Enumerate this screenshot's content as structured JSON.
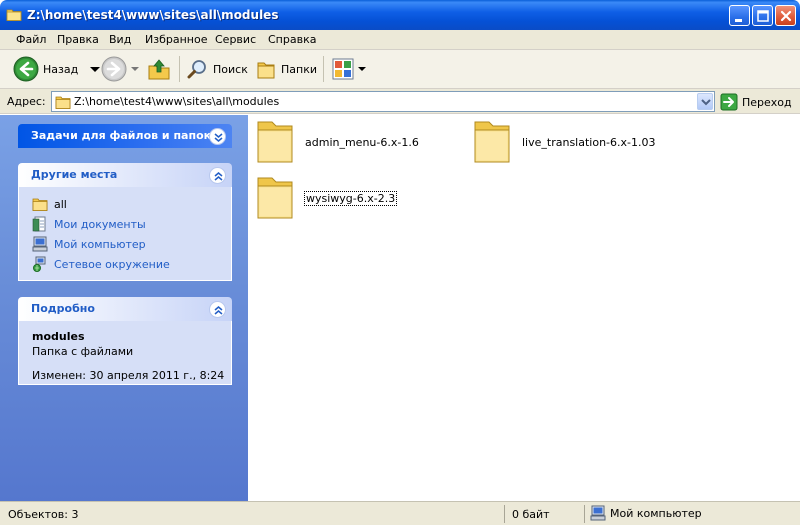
{
  "window": {
    "title": "Z:\\home\\test4\\www\\sites\\all\\modules"
  },
  "menu": [
    "Файл",
    "Правка",
    "Вид",
    "Избранное",
    "Сервис",
    "Справка"
  ],
  "toolbar": {
    "back": "Назад",
    "search": "Поиск",
    "folders": "Папки"
  },
  "address": {
    "label": "Адрес:",
    "value": "Z:\\home\\test4\\www\\sites\\all\\modules",
    "go": "Переход"
  },
  "tasks": {
    "file_tasks_title": "Задачи для файлов и папок",
    "other_places_title": "Другие места",
    "other_places": [
      {
        "label": "all",
        "icon": "folder-icon"
      },
      {
        "label": "Мои документы",
        "icon": "my-documents-icon"
      },
      {
        "label": "Мой компьютер",
        "icon": "my-computer-icon"
      },
      {
        "label": "Сетевое окружение",
        "icon": "network-places-icon"
      }
    ],
    "details_title": "Подробно",
    "details": {
      "name": "modules",
      "type": "Папка с файлами",
      "modified": "Изменен: 30 апреля 2011 г., 8:24"
    }
  },
  "folders": [
    {
      "name": "admin_menu-6.x-1.6",
      "selected": false
    },
    {
      "name": "live_translation-6.x-1.03",
      "selected": false
    },
    {
      "name": "wysiwyg-6.x-2.3",
      "selected": true
    }
  ],
  "status": {
    "objects": "Объектов: 3",
    "size": "0 байт",
    "location": "Мой компьютер"
  }
}
